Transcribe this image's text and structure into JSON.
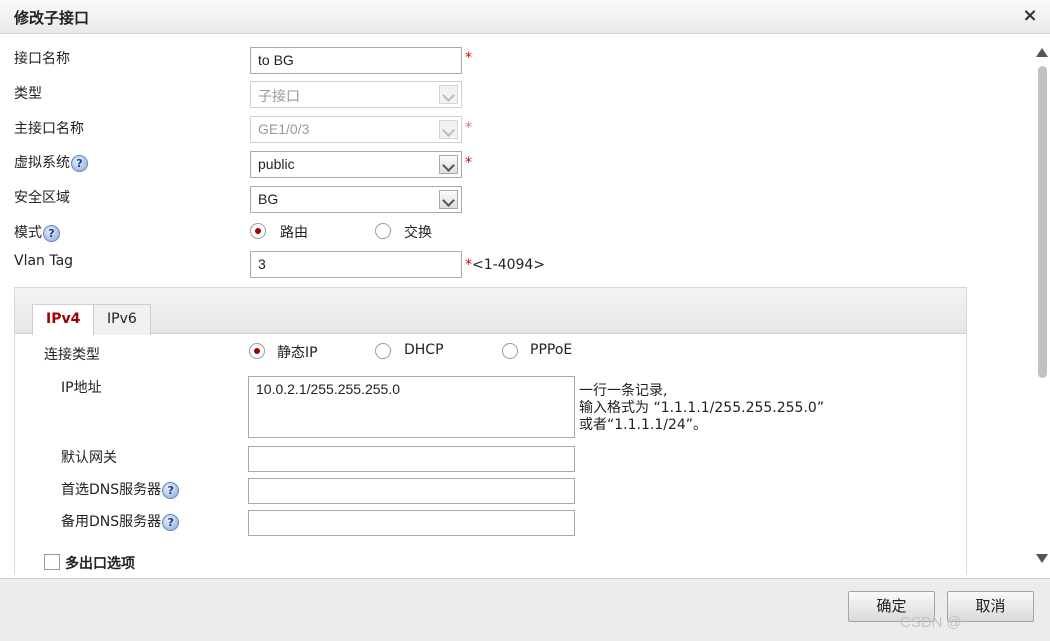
{
  "dialog": {
    "title": "修改子接口"
  },
  "form": {
    "interface_name": {
      "label": "接口名称",
      "value": "to BG",
      "required_mark": "*"
    },
    "type": {
      "label": "类型",
      "value": "子接口"
    },
    "main_interface": {
      "label": "主接口名称",
      "value": "GE1/0/3",
      "required_mark": "*"
    },
    "vsys": {
      "label": "虚拟系统",
      "value": "public",
      "required_mark": "*"
    },
    "zone": {
      "label": "安全区域",
      "value": "BG"
    },
    "mode": {
      "label": "模式",
      "options": [
        "路由",
        "交换"
      ],
      "selected": "路由"
    },
    "vlan_tag": {
      "label": "Vlan Tag",
      "value": "3",
      "hint": "*<1-4094>"
    }
  },
  "tabs": [
    {
      "label": "IPv4",
      "active": true
    },
    {
      "label": "IPv6",
      "active": false
    }
  ],
  "ipv4": {
    "connection_type": {
      "label": "连接类型",
      "options": [
        "静态IP",
        "DHCP",
        "PPPoE"
      ],
      "selected": "静态IP"
    },
    "ip_address": {
      "label": "IP地址",
      "value": "10.0.2.1/255.255.255.0",
      "hint_lines": [
        "一行一条记录,",
        "输入格式为 “1.1.1.1/255.255.255.0”",
        "或者“1.1.1.1/24”。"
      ]
    },
    "gateway": {
      "label": "默认网关",
      "value": ""
    },
    "dns_primary": {
      "label": "首选DNS服务器",
      "value": ""
    },
    "dns_backup": {
      "label": "备用DNS服务器",
      "value": ""
    },
    "multi_egress": {
      "label": "多出口选项",
      "checked": false
    }
  },
  "icons": {
    "help": "?",
    "close": "×"
  },
  "footer": {
    "ok_label": "确定",
    "cancel_label": "取消"
  },
  "watermark": "CSDN @"
}
